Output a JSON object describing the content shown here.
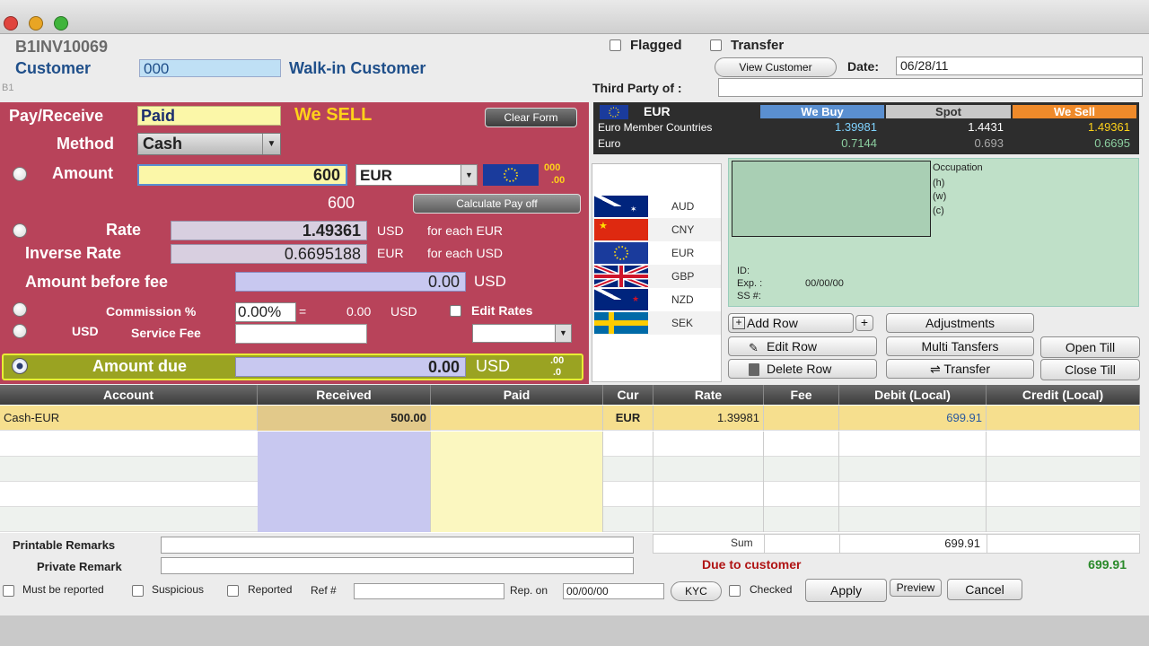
{
  "invoice_id": "B1INV10069",
  "branch": "B1",
  "customer": {
    "label": "Customer",
    "code": "000",
    "name": "Walk-in Customer"
  },
  "flags": {
    "flagged": "Flagged",
    "transfer": "Transfer"
  },
  "view_customer": "View Customer",
  "date": {
    "label": "Date:",
    "value": "06/28/11"
  },
  "third_party": {
    "label": "Third Party of :",
    "value": ""
  },
  "pay": {
    "pay_receive_label": "Pay/Receive",
    "pay_receive_value": "Paid",
    "we_sell": "We SELL",
    "clear_form": "Clear Form",
    "method_label": "Method",
    "method_value": "Cash",
    "amount_label": "Amount",
    "amount_value": "600",
    "amount_currency": "EUR",
    "amount_sub": "600",
    "dec1": "000",
    "dec2": ".00",
    "calc_payoff": "Calculate Pay off",
    "rate_label": "Rate",
    "rate_value": "1.49361",
    "rate_cur": "USD",
    "rate_for": "for each EUR",
    "inv_label": "Inverse Rate",
    "inv_value": "0.6695188",
    "inv_cur": "EUR",
    "inv_for": "for each USD",
    "abf_label": "Amount before fee",
    "abf_value": "0.00",
    "abf_cur": "USD",
    "commission_label": "Commission %",
    "commission_value": "0.00%",
    "eq": "=",
    "commission_amt": "0.00",
    "commission_cur": "USD",
    "edit_rates": "Edit Rates",
    "usd": "USD",
    "service_fee_label": "Service Fee",
    "amount_due_label": "Amount due",
    "amount_due_value": "0.00",
    "amount_due_cur": "USD",
    "due_dec1": ".00",
    "due_dec2": ".0"
  },
  "rate_panel": {
    "currency": "EUR",
    "country": "Euro Member Countries",
    "name": "Euro",
    "we_buy": "We Buy",
    "spot": "Spot",
    "we_sell": "We Sell",
    "buy1": "1.39981",
    "spot1": "1.4431",
    "sell1": "1.49361",
    "buy2": "0.7144",
    "spot2": "0.693",
    "sell2": "0.6695",
    "colors": {
      "buy": "#5a8fd0",
      "spot": "#c8c8c8",
      "sell": "#ef8a2a"
    }
  },
  "currencies": [
    "AUD",
    "CNY",
    "EUR",
    "GBP",
    "NZD",
    "SEK"
  ],
  "occupation": {
    "label": "Occupation",
    "h": "(h)",
    "w": "(w)",
    "c": "(c)",
    "id": "ID:",
    "exp": "Exp. :",
    "exp_value": "00/00/00",
    "ss": "SS #:"
  },
  "actions": {
    "add_row": "Add Row",
    "plus": "+",
    "edit_row": "Edit Row",
    "delete_row": "Delete Row",
    "adjustments": "Adjustments",
    "multi_transfers": "Multi Tansfers",
    "transfer": "Transfer",
    "open_till": "Open Till",
    "close_till": "Close Till"
  },
  "table": {
    "headers": [
      "Account",
      "Received",
      "Paid",
      "Cur",
      "Rate",
      "Fee",
      "Debit (Local)",
      "Credit (Local)"
    ],
    "rows": [
      {
        "account": "Cash-EUR",
        "received": "500.00",
        "paid": "",
        "cur": "EUR",
        "rate": "1.39981",
        "fee": "",
        "debit": "699.91",
        "credit": ""
      }
    ]
  },
  "remarks": {
    "printable": "Printable Remarks",
    "private": "Private Remark"
  },
  "totals": {
    "sum_label": "Sum",
    "sum_value": "699.91",
    "due_label": "Due to customer",
    "due_value": "699.91"
  },
  "bottom": {
    "must_report": "Must be reported",
    "suspicious": "Suspicious",
    "reported": "Reported",
    "ref": "Ref #",
    "rep_on": "Rep. on",
    "rep_value": "00/00/00",
    "kyc": "KYC",
    "checked": "Checked",
    "apply": "Apply",
    "preview": "Preview",
    "cancel": "Cancel"
  }
}
